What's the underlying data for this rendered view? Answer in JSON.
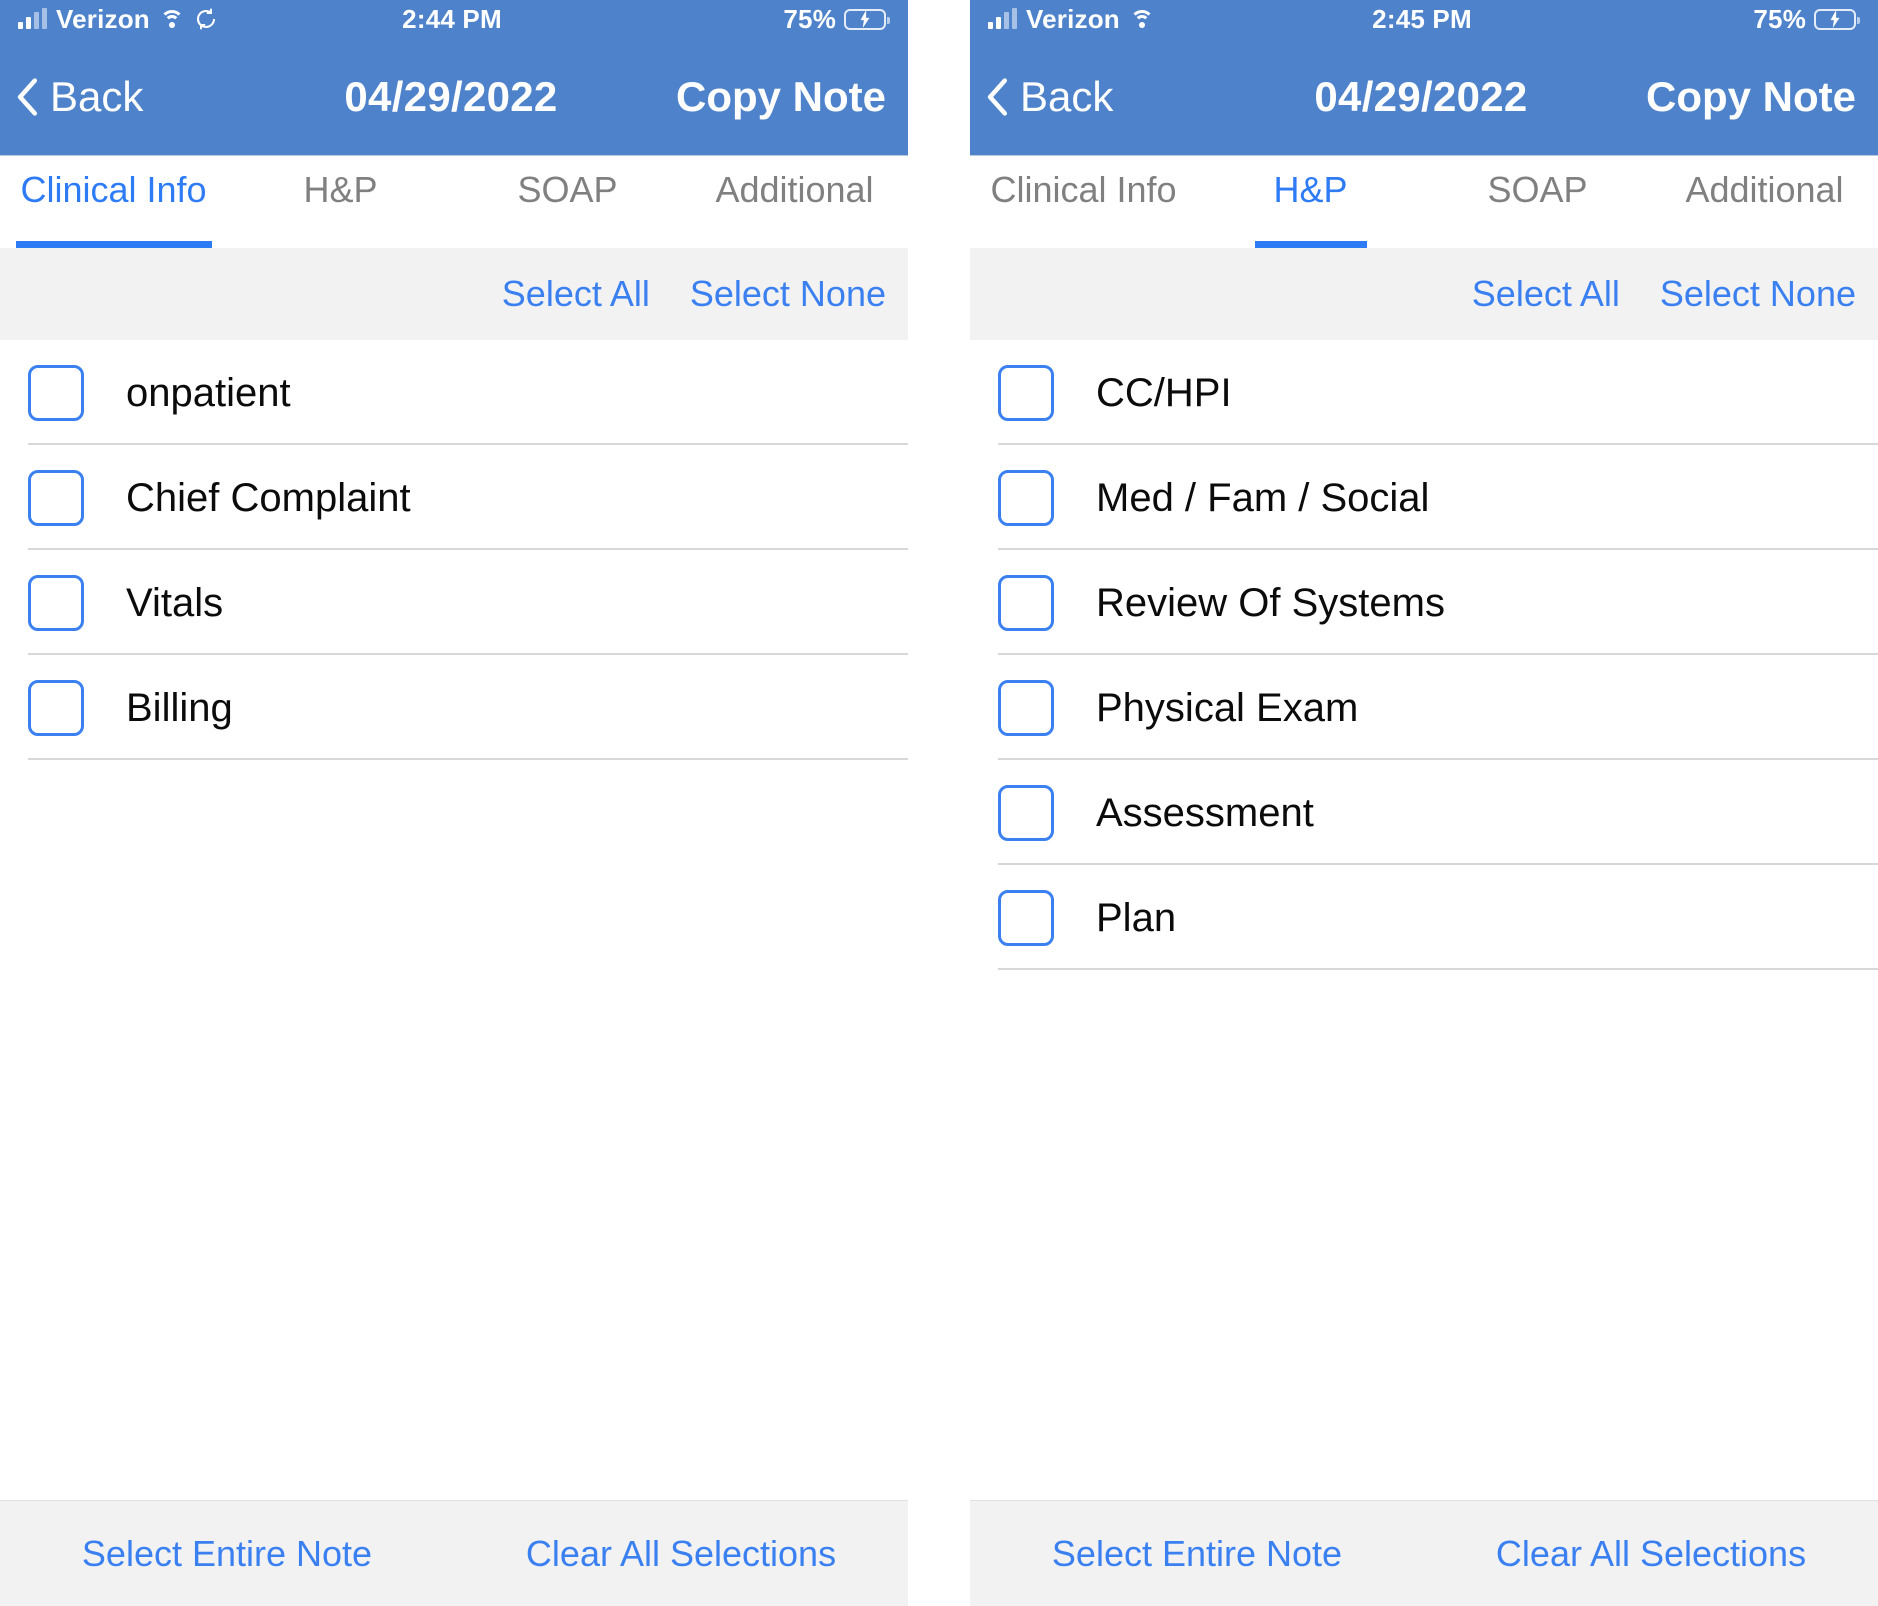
{
  "panels": [
    {
      "status": {
        "carrier": "Verizon",
        "time": "2:44 PM",
        "battery_pct": "75%",
        "battery_level": 75,
        "has_rotation_lock": true,
        "icons": [
          "signal-icon",
          "wifi-icon",
          "rotation-lock-icon",
          "battery-charging-icon"
        ]
      },
      "nav": {
        "back_label": "Back",
        "title": "04/29/2022",
        "action_label": "Copy Note"
      },
      "tabs": [
        {
          "label": "Clinical Info",
          "active": true
        },
        {
          "label": "H&P",
          "active": false
        },
        {
          "label": "SOAP",
          "active": false
        },
        {
          "label": "Additional",
          "active": false
        }
      ],
      "select_strip": {
        "select_all": "Select All",
        "select_none": "Select None"
      },
      "items": [
        {
          "label": "onpatient",
          "checked": false
        },
        {
          "label": "Chief Complaint",
          "checked": false
        },
        {
          "label": "Vitals",
          "checked": false
        },
        {
          "label": "Billing",
          "checked": false
        }
      ],
      "bottom": {
        "select_entire_note": "Select Entire Note",
        "clear_all_selections": "Clear All Selections"
      }
    },
    {
      "status": {
        "carrier": "Verizon",
        "time": "2:45 PM",
        "battery_pct": "75%",
        "battery_level": 75,
        "has_rotation_lock": false,
        "icons": [
          "signal-icon",
          "wifi-icon",
          "battery-charging-icon"
        ]
      },
      "nav": {
        "back_label": "Back",
        "title": "04/29/2022",
        "action_label": "Copy Note"
      },
      "tabs": [
        {
          "label": "Clinical Info",
          "active": false
        },
        {
          "label": "H&P",
          "active": true
        },
        {
          "label": "SOAP",
          "active": false
        },
        {
          "label": "Additional",
          "active": false
        }
      ],
      "select_strip": {
        "select_all": "Select All",
        "select_none": "Select None"
      },
      "items": [
        {
          "label": "CC/HPI",
          "checked": false
        },
        {
          "label": "Med / Fam / Social",
          "checked": false
        },
        {
          "label": "Review Of Systems",
          "checked": false
        },
        {
          "label": "Physical Exam",
          "checked": false
        },
        {
          "label": "Assessment",
          "checked": false
        },
        {
          "label": "Plan",
          "checked": false
        }
      ],
      "bottom": {
        "select_entire_note": "Select Entire Note",
        "clear_all_selections": "Clear All Selections"
      }
    }
  ],
  "colors": {
    "header_blue": "#4e83cc",
    "accent_blue": "#3b80f0",
    "tab_active_blue": "#2e7bf6",
    "strip_gray": "#f2f2f3",
    "battery_green": "#53d769",
    "divider": "#d8d8d8"
  }
}
